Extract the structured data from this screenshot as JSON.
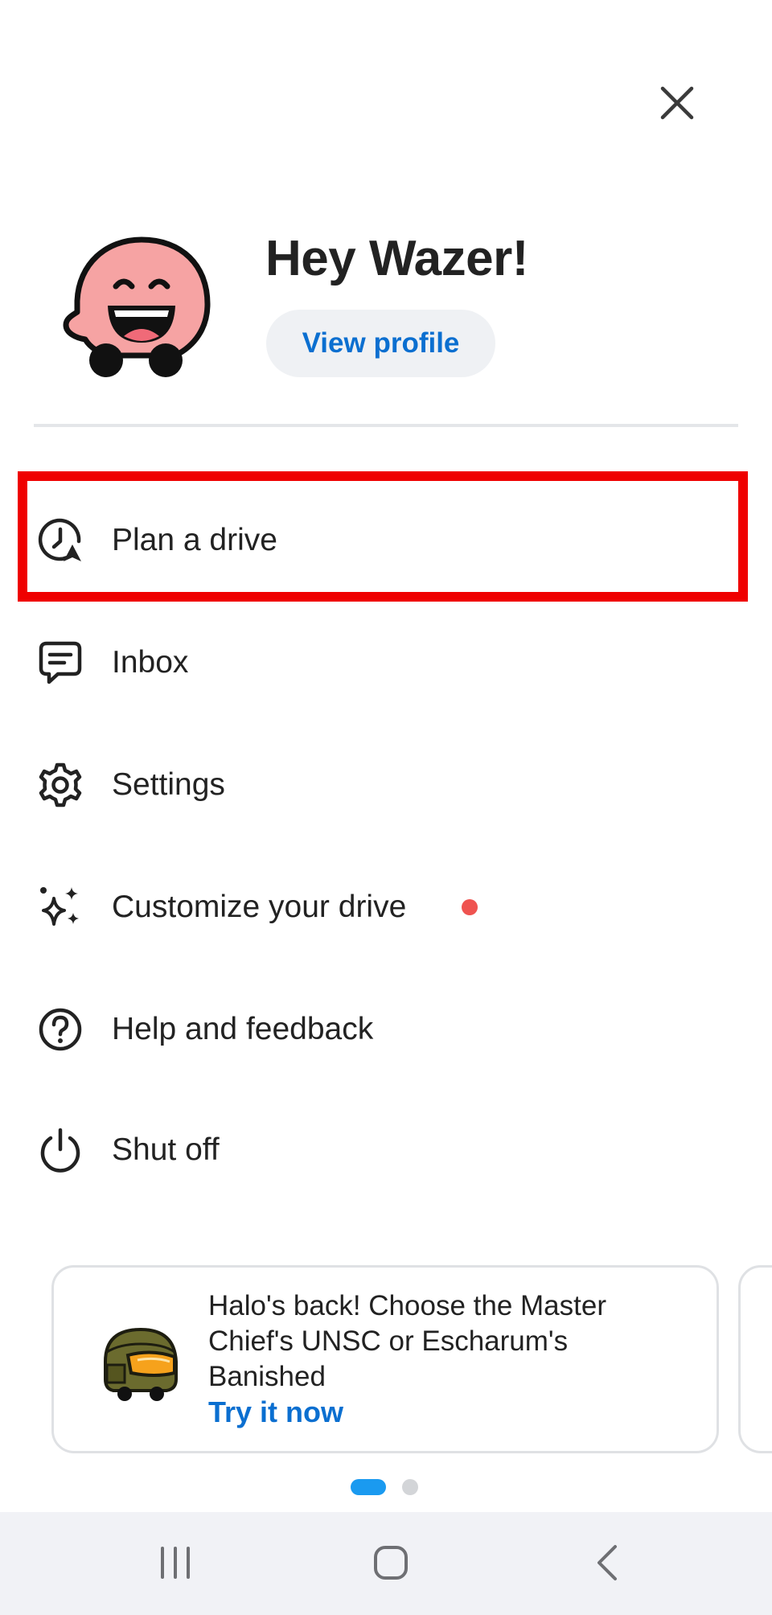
{
  "header": {
    "close_icon": "close-icon"
  },
  "profile": {
    "avatar_icon": "wazer-smiley-avatar",
    "greeting": "Hey Wazer!",
    "view_profile_label": "View profile"
  },
  "menu": {
    "items": [
      {
        "id": "plan-drive",
        "label": "Plan a drive",
        "icon": "clock-arrow-icon",
        "highlighted": true
      },
      {
        "id": "inbox",
        "label": "Inbox",
        "icon": "chat-bubble-icon"
      },
      {
        "id": "settings",
        "label": "Settings",
        "icon": "gear-icon"
      },
      {
        "id": "customize",
        "label": "Customize your drive",
        "icon": "sparkles-icon",
        "has_notification": true
      },
      {
        "id": "help",
        "label": "Help and feedback",
        "icon": "question-circle-icon"
      },
      {
        "id": "shut-off",
        "label": "Shut off",
        "icon": "power-icon"
      }
    ]
  },
  "promo": {
    "image_icon": "halo-helmet-icon",
    "text": "Halo's back! Choose the Master Chief's UNSC or Escharum's Banished",
    "cta_label": "Try it now"
  },
  "pager": {
    "total": 2,
    "active_index": 0
  },
  "navbar": {
    "recents_icon": "recents-icon",
    "home_icon": "home-icon",
    "back_icon": "back-icon"
  },
  "colors": {
    "accent_blue": "#0b6fd0",
    "highlight_red": "#ef0000",
    "notification_dot": "#ef5350",
    "pager_active": "#1a9af0",
    "avatar_pink": "#f6a3a3"
  }
}
